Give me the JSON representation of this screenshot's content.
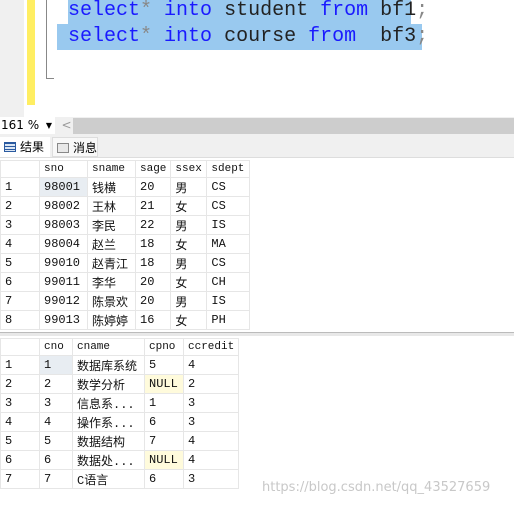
{
  "editor": {
    "line1": {
      "kw1": "select",
      "op": "*",
      "kw2": "into",
      "name": "student",
      "kw3": "from",
      "src": "bf1",
      "end": ";"
    },
    "line2": {
      "kw1": "select",
      "op": "*",
      "kw2": "into",
      "name": "course",
      "kw3": "from",
      "src": " bf3",
      "end": ";"
    }
  },
  "zoom": {
    "value": "161 %"
  },
  "tabs": [
    {
      "label": "结果",
      "icon": "grid-icon"
    },
    {
      "label": "消息",
      "icon": "messages-icon"
    }
  ],
  "grid1": {
    "columns": [
      "sno",
      "sname",
      "sage",
      "ssex",
      "sdept"
    ],
    "rows": [
      [
        "1",
        "98001",
        "钱横",
        "20",
        "男",
        "CS"
      ],
      [
        "2",
        "98002",
        "王林",
        "21",
        "女",
        "CS"
      ],
      [
        "3",
        "98003",
        "李民",
        "22",
        "男",
        "IS"
      ],
      [
        "4",
        "98004",
        "赵兰",
        "18",
        "女",
        "MA"
      ],
      [
        "5",
        "99010",
        "赵青江",
        "18",
        "男",
        "CS"
      ],
      [
        "6",
        "99011",
        "李华",
        "20",
        "女",
        "CH"
      ],
      [
        "7",
        "99012",
        "陈景欢",
        "20",
        "男",
        "IS"
      ],
      [
        "8",
        "99013",
        "陈婷婷",
        "16",
        "女",
        "PH"
      ]
    ]
  },
  "grid2": {
    "columns": [
      "cno",
      "cname",
      "cpno",
      "ccredit"
    ],
    "rows": [
      [
        "1",
        "1",
        "数据库系统",
        "5",
        "4"
      ],
      [
        "2",
        "2",
        "数学分析",
        "NULL",
        "2"
      ],
      [
        "3",
        "3",
        "信息系...",
        "1",
        "3"
      ],
      [
        "4",
        "4",
        "操作系...",
        "6",
        "3"
      ],
      [
        "5",
        "5",
        "数据结构",
        "7",
        "4"
      ],
      [
        "6",
        "6",
        "数据处...",
        "NULL",
        "4"
      ],
      [
        "7",
        "7",
        "C语言",
        "6",
        "3"
      ]
    ]
  },
  "watermark": "https://blog.csdn.net/qq_43527659"
}
